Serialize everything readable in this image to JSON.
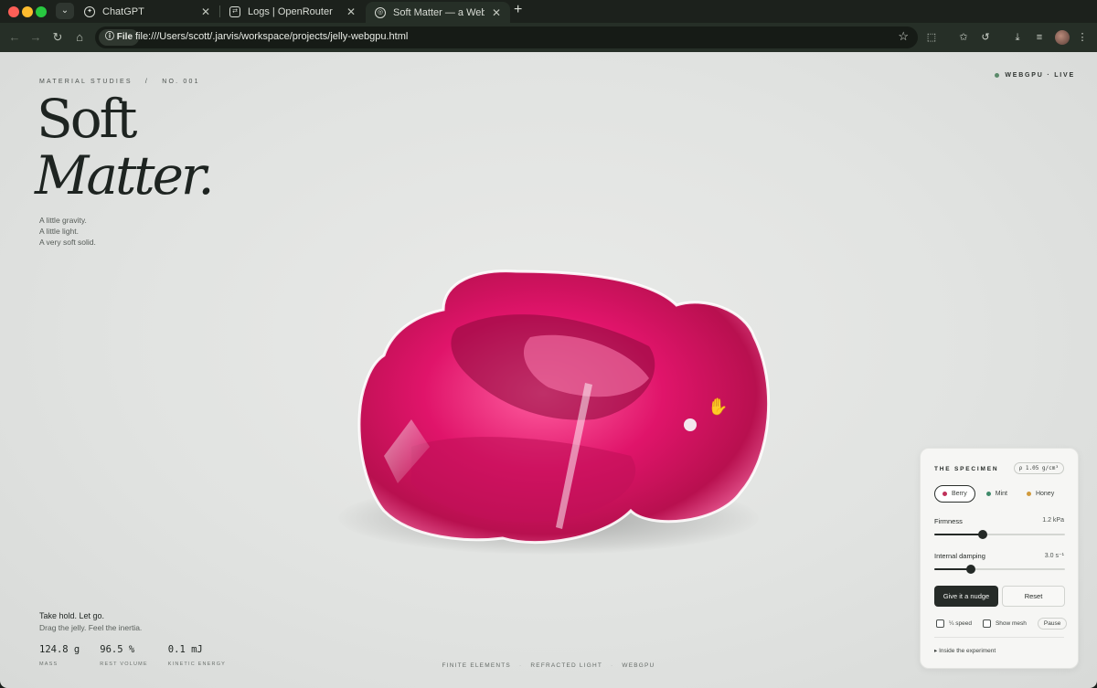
{
  "browser": {
    "tabs": [
      {
        "title": "ChatGPT",
        "favicon": "openai-icon"
      },
      {
        "title": "Logs | OpenRouter",
        "favicon": "openrouter-icon"
      },
      {
        "title": "Soft Matter — a WebGPU jelly",
        "favicon": "globe-icon",
        "active": true
      }
    ],
    "address": {
      "chip": "File",
      "url": "file:///Users/scott/.jarvis/workspace/projects/jelly-webgpu.html"
    }
  },
  "page": {
    "eyebrow_left": "MATERIAL STUDIES",
    "eyebrow_sep": "/",
    "eyebrow_right": "NO. 001",
    "status": "WEBGPU · LIVE",
    "title_line1": "Soft",
    "title_line2": "Matter.",
    "tagline": [
      "A little gravity.",
      "A little light.",
      "A very soft solid."
    ],
    "prompt_head": "Take hold. Let go.",
    "prompt_sub": "Drag the jelly. Feel the inertia.",
    "stats": [
      {
        "value": "124.8 g",
        "label": "MASS"
      },
      {
        "value": "96.5 %",
        "label": "REST VOLUME"
      },
      {
        "value": "0.1 mJ",
        "label": "KINETIC ENERGY"
      }
    ],
    "footer_tags": [
      "FINITE ELEMENTS",
      "REFRACTED LIGHT",
      "WEBGPU"
    ],
    "footer_sep": "·"
  },
  "panel": {
    "title": "THE SPECIMEN",
    "density": "ρ 1.05 g/cm³",
    "flavors": [
      {
        "label": "Berry",
        "color": "#c0315a",
        "active": true
      },
      {
        "label": "Mint",
        "color": "#3f8a6a",
        "active": false
      },
      {
        "label": "Honey",
        "color": "#d19a3c",
        "active": false
      }
    ],
    "firmness": {
      "label": "Firmness",
      "value": "1.2 kPa",
      "fraction": 0.37
    },
    "damping": {
      "label": "Internal damping",
      "value": "3.0 s⁻¹",
      "fraction": 0.28
    },
    "nudge_label": "Give it a nudge",
    "reset_label": "Reset",
    "checks": [
      {
        "label": "¼ speed",
        "checked": false
      },
      {
        "label": "Show mesh",
        "checked": false
      }
    ],
    "pause_label": "Pause",
    "details_label": "▸ Inside the experiment"
  },
  "colors": {
    "jelly": "#e0146a",
    "ink": "#1e2421",
    "accent_live": "#5b8a6a"
  }
}
